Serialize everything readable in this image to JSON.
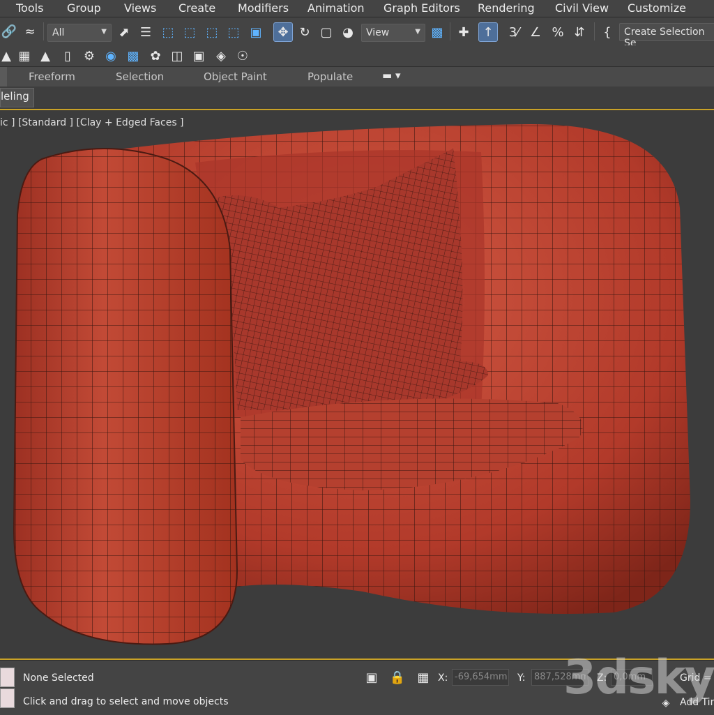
{
  "menubar": {
    "items": [
      "Tools",
      "Group",
      "Views",
      "Create",
      "Modifiers",
      "Animation",
      "Graph Editors",
      "Rendering",
      "Civil View",
      "Customize"
    ]
  },
  "toolbar": {
    "selection_filter": "All",
    "reference_coord": "View",
    "create_selection_set": "Create Selection Se"
  },
  "ribbon": {
    "tabs": [
      "Freeform",
      "Selection",
      "Object Paint",
      "Populate"
    ],
    "active_subtab": "leling"
  },
  "viewport": {
    "label": "ic ] [Standard ] [Clay + Edged Faces ]",
    "object_color": "#b23a2a"
  },
  "statusbar": {
    "selection_status": "None Selected",
    "prompt": "Click and drag to select and move objects",
    "x_label": "X:",
    "x_value": "-69,654mm",
    "y_label": "Y:",
    "y_value": "887,528mm",
    "z_label": "Z:",
    "z_value": "0,0mm",
    "grid_label": "Grid =",
    "add_time_tag": "Add Tim"
  },
  "watermark": "3dsky"
}
